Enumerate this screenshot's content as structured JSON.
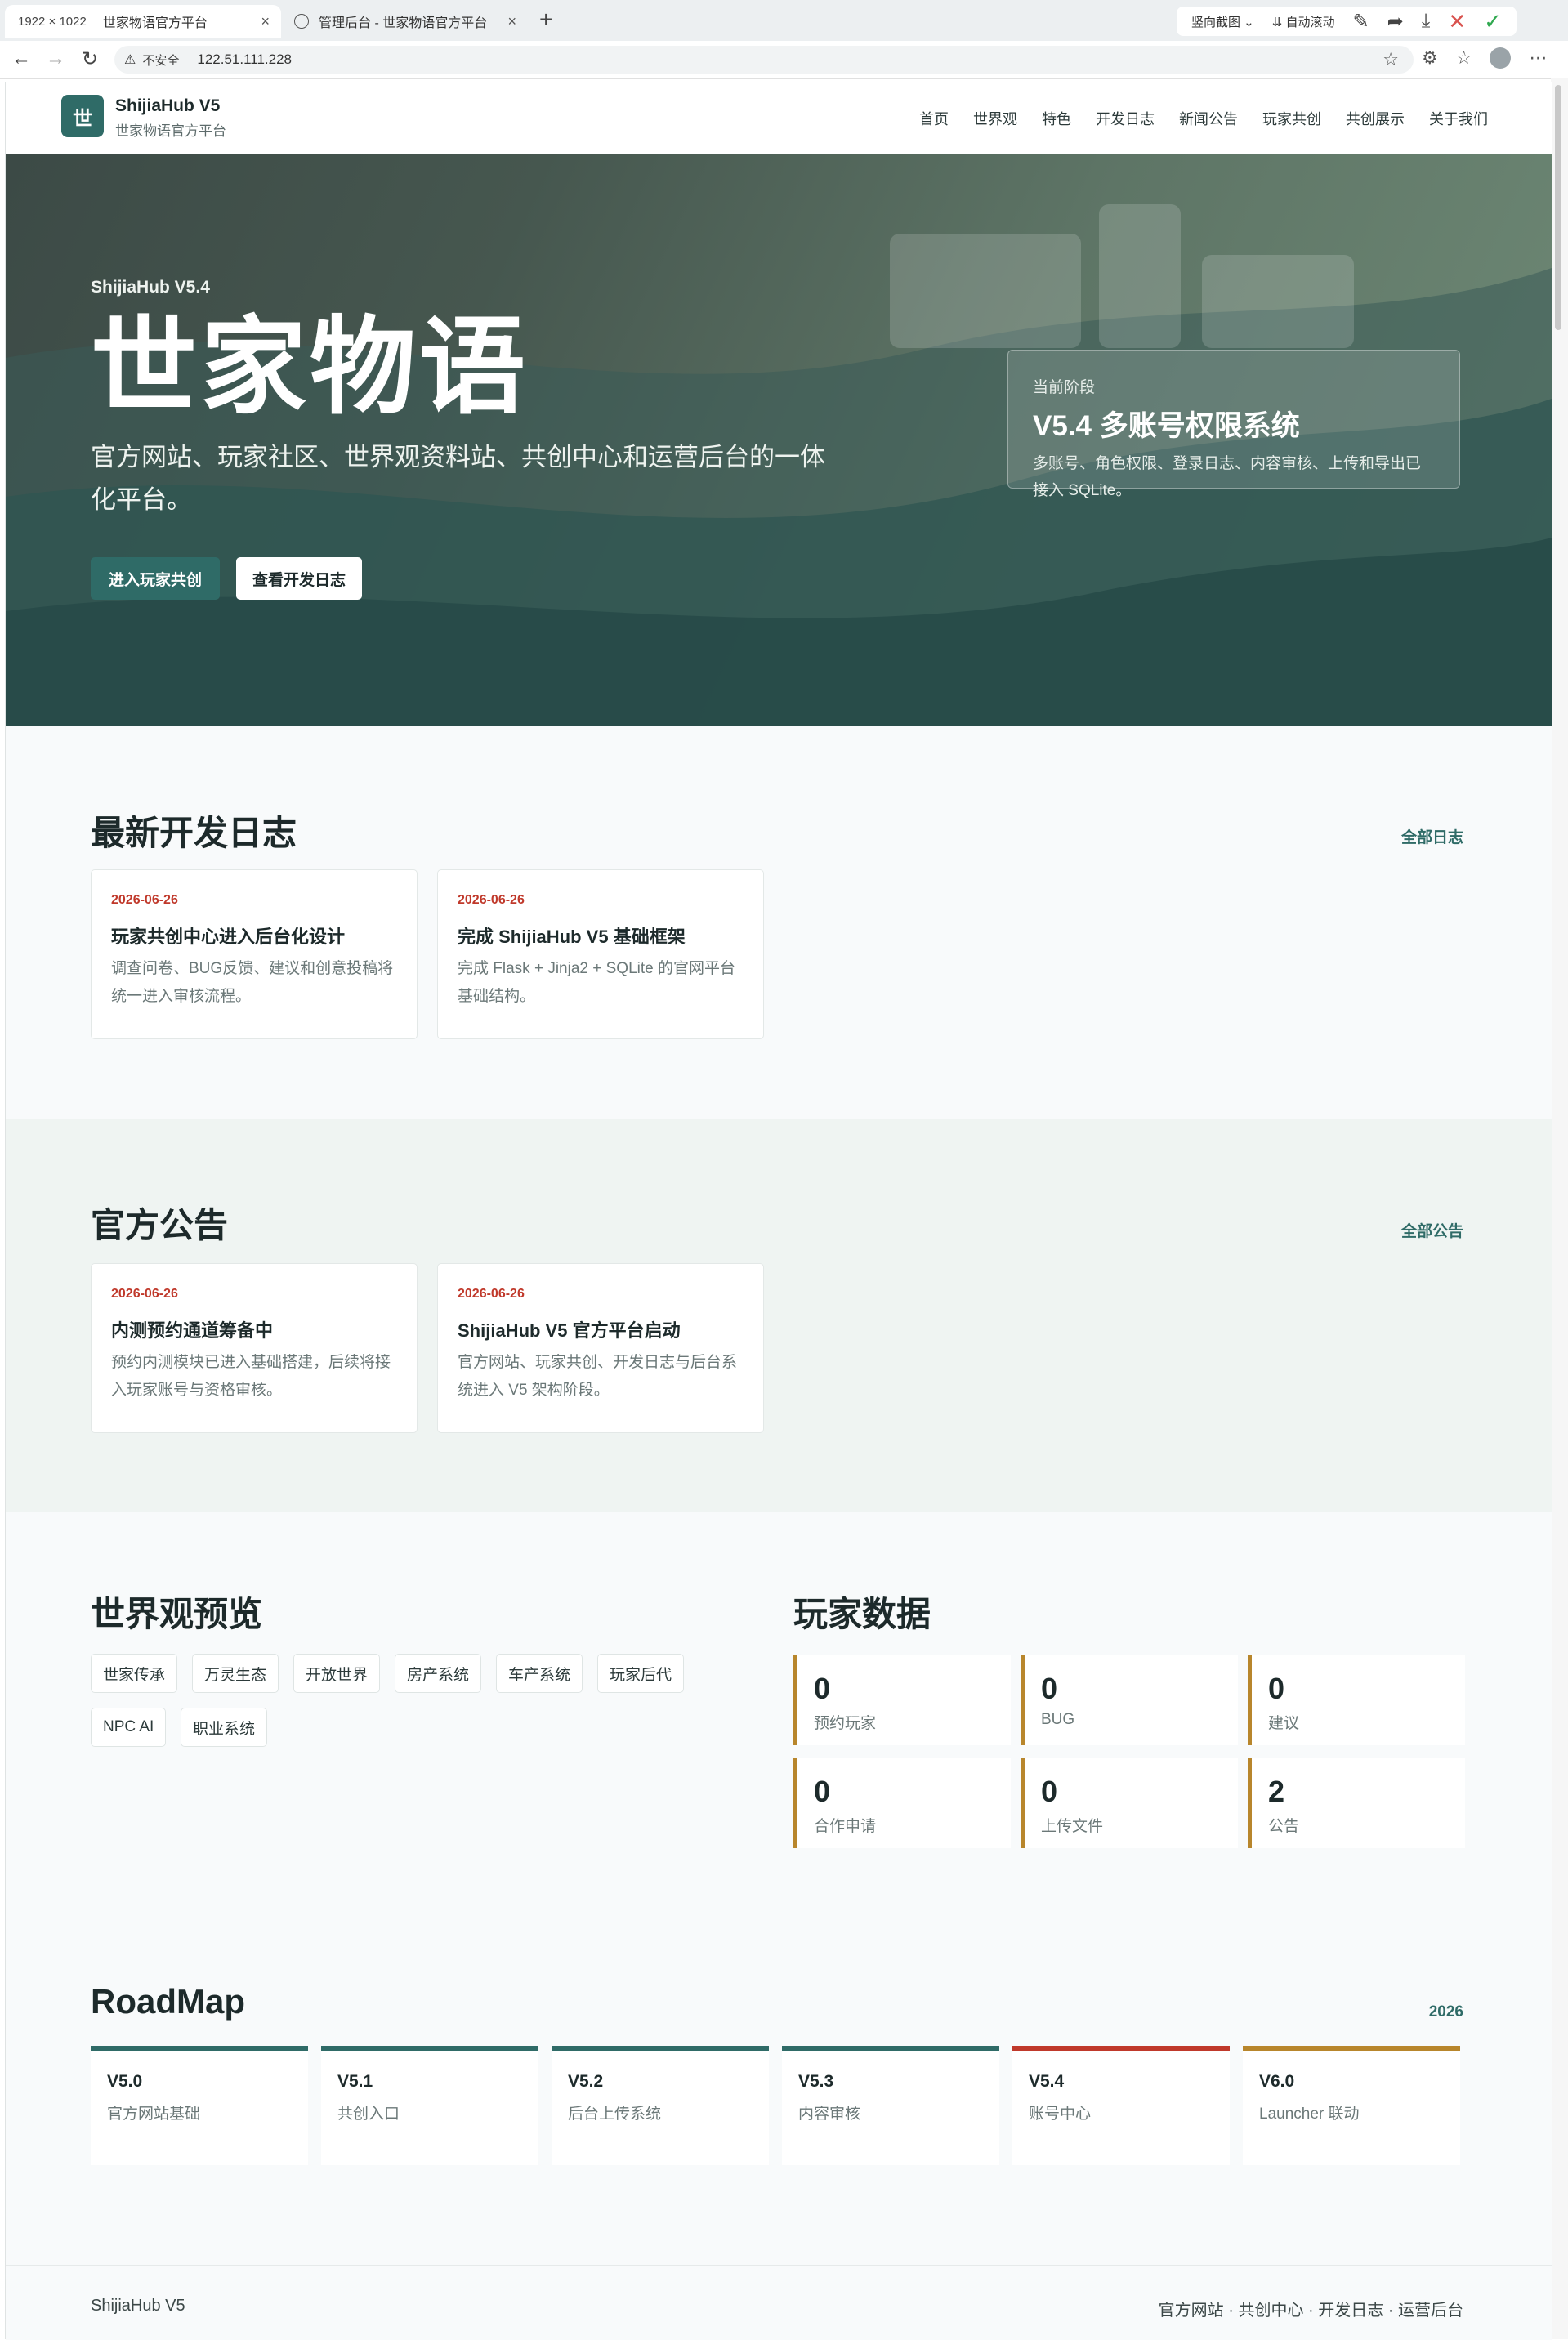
{
  "browser": {
    "tabs": [
      {
        "size": "1922 × 1022",
        "title": "世家物语官方平台",
        "close": "×"
      },
      {
        "title": "管理后台 - 世家物语官方平台",
        "close": "×"
      }
    ],
    "new_tab": "+",
    "capture_mode": "竖向截图",
    "auto_scroll": "自动滚动",
    "security_label": "不安全",
    "url": "122.51.111.228"
  },
  "site": {
    "logo_char": "世",
    "brand_title": "ShijiaHub V5",
    "brand_subtitle": "世家物语官方平台",
    "nav": [
      "首页",
      "世界观",
      "特色",
      "开发日志",
      "新闻公告",
      "玩家共创",
      "共创展示",
      "关于我们"
    ]
  },
  "hero": {
    "version": "ShijiaHub V5.4",
    "title": "世家物语",
    "description": "官方网站、玩家社区、世界观资料站、共创中心和运营后台的一体化平台。",
    "primary_button": "进入玩家共创",
    "secondary_button": "查看开发日志",
    "stage": {
      "label": "当前阶段",
      "title": "V5.4 多账号权限系统",
      "description": "多账号、角色权限、登录日志、内容审核、上传和导出已接入 SQLite。"
    }
  },
  "devlog": {
    "title": "最新开发日志",
    "link": "全部日志",
    "cards": [
      {
        "date": "2026-06-26",
        "title": "玩家共创中心进入后台化设计",
        "text": "调查问卷、BUG反馈、建议和创意投稿将统一进入审核流程。"
      },
      {
        "date": "2026-06-26",
        "title": "完成 ShijiaHub V5 基础框架",
        "text": "完成 Flask + Jinja2 + SQLite 的官网平台基础结构。"
      }
    ]
  },
  "announcements": {
    "title": "官方公告",
    "link": "全部公告",
    "cards": [
      {
        "date": "2026-06-26",
        "title": "内测预约通道筹备中",
        "text": "预约内测模块已进入基础搭建，后续将接入玩家账号与资格审核。"
      },
      {
        "date": "2026-06-26",
        "title": "ShijiaHub V5 官方平台启动",
        "text": "官方网站、玩家共创、开发日志与后台系统进入 V5 架构阶段。"
      }
    ]
  },
  "world": {
    "title": "世界观预览",
    "tags": [
      "世家传承",
      "万灵生态",
      "开放世界",
      "房产系统",
      "车产系统",
      "玩家后代",
      "NPC AI",
      "职业系统"
    ]
  },
  "stats": {
    "title": "玩家数据",
    "items": [
      {
        "value": "0",
        "label": "预约玩家"
      },
      {
        "value": "0",
        "label": "BUG"
      },
      {
        "value": "0",
        "label": "建议"
      },
      {
        "value": "0",
        "label": "合作申请"
      },
      {
        "value": "0",
        "label": "上传文件"
      },
      {
        "value": "2",
        "label": "公告"
      }
    ]
  },
  "roadmap": {
    "title": "RoadMap",
    "year": "2026",
    "items": [
      {
        "version": "V5.0",
        "name": "官方网站基础"
      },
      {
        "version": "V5.1",
        "name": "共创入口"
      },
      {
        "version": "V5.2",
        "name": "后台上传系统"
      },
      {
        "version": "V5.3",
        "name": "内容审核"
      },
      {
        "version": "V5.4",
        "name": "账号中心"
      },
      {
        "version": "V6.0",
        "name": "Launcher 联动"
      }
    ]
  },
  "footer": {
    "brand": "ShijiaHub V5",
    "links": "官方网站 · 共创中心 · 开发日志 · 运营后台"
  },
  "colors": {
    "accent": "#2f6b67",
    "date_red": "#c0392b",
    "stat_gold": "#b8862c",
    "roadmap_current": "#c0392b"
  }
}
